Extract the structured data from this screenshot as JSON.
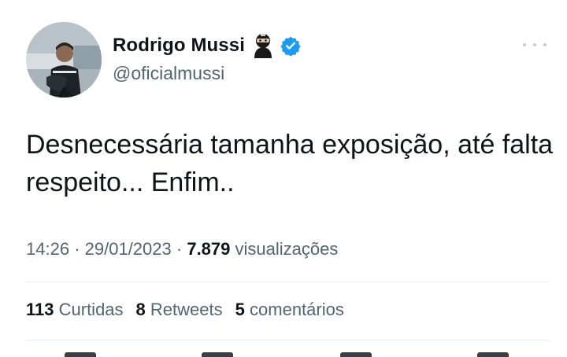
{
  "tweet": {
    "display_name": "Rodrigo Mussi",
    "handle": "@oficialmussi",
    "text": "Desnecessária tamanha exposição, até falta respeito... Enfim..",
    "time": "14:26",
    "date": "29/01/2023",
    "views_count": "7.879",
    "views_label": "visualizações",
    "separator": "·"
  },
  "stats": {
    "likes_count": "113",
    "likes_label": "Curtidas",
    "retweets_count": "8",
    "retweets_label": "Retweets",
    "comments_count": "5",
    "comments_label": "comentários"
  },
  "icons": {
    "verified": "verified-badge-icon",
    "name_emoji": "ninja-emoji-icon",
    "more": "more-options-icon"
  },
  "colors": {
    "verified_blue": "#1d9bf0",
    "secondary_text": "#536471",
    "primary_text": "#0f1419",
    "divider": "#e6ecf0"
  }
}
